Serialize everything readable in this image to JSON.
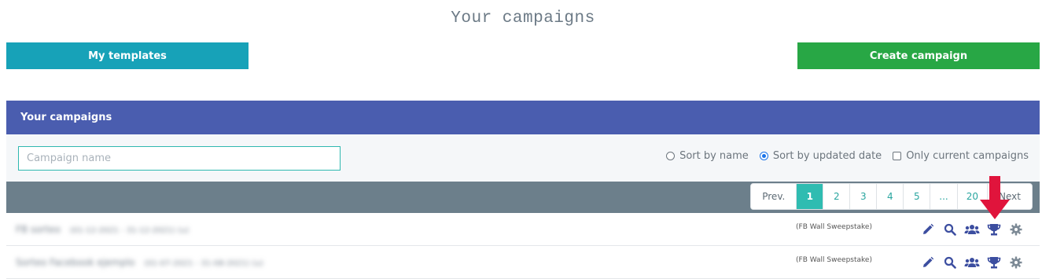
{
  "page": {
    "title": "Your campaigns"
  },
  "buttons": {
    "templates": "My templates",
    "create": "Create campaign"
  },
  "panel": {
    "header": "Your campaigns",
    "search": {
      "placeholder": "Campaign name",
      "value": ""
    },
    "sort": {
      "by_name": "Sort by name",
      "by_updated": "Sort by updated date",
      "current_only": "Only current campaigns",
      "selected": "by_updated"
    },
    "pagination": {
      "prev": "Prev.",
      "pages": [
        "1",
        "2",
        "3",
        "4",
        "5",
        "...",
        "20"
      ],
      "current": "1",
      "next": "Next"
    },
    "rows": [
      {
        "name": "FB sorteo",
        "dates": "(01-12-2021 - 31-12-2021) (u)",
        "type": "(FB Wall Sweepstake)"
      },
      {
        "name": "Sorteo Facebook ejemplo",
        "dates": "(01-07-2021 - 31-08-2021) (u)",
        "type": "(FB Wall Sweepstake)"
      }
    ],
    "row_actions": [
      "pencil-icon",
      "search-icon",
      "users-icon",
      "trophy-icon",
      "gear-icon"
    ]
  },
  "colors": {
    "header": "#4a5daf",
    "templates_button": "#17a2b8",
    "create_button": "#28a745",
    "pager_bar": "#6c7f8b",
    "active_page": "#2fbcb1",
    "action_icons": "#3c4ea0",
    "annotation_arrow": "#e0143c"
  }
}
